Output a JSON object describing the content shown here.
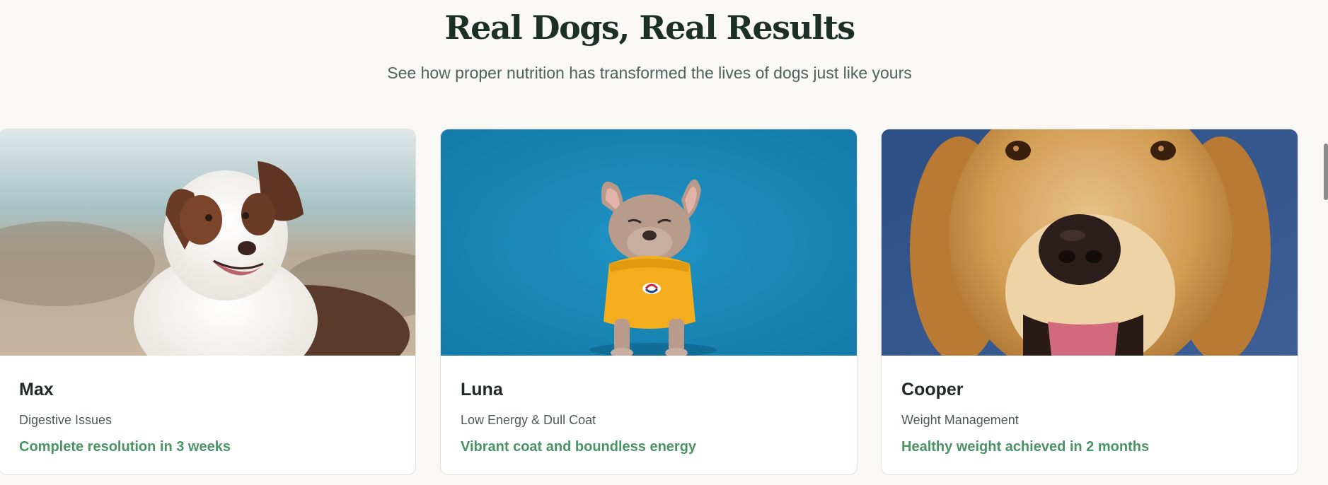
{
  "section": {
    "title": "Real Dogs, Real Results",
    "subtitle": "See how proper nutrition has transformed the lives of dogs just like yours"
  },
  "cards": [
    {
      "name": "Max",
      "issue": "Digestive Issues",
      "result": "Complete resolution in 3 weeks",
      "photo": "australian-shepherd-photo"
    },
    {
      "name": "Luna",
      "issue": "Low Energy & Dull Coat",
      "result": "Vibrant coat and boundless energy",
      "photo": "french-bulldog-photo"
    },
    {
      "name": "Cooper",
      "issue": "Weight Management",
      "result": "Healthy weight achieved in 2 months",
      "photo": "golden-retriever-photo"
    }
  ],
  "colors": {
    "background": "#f9f8f4",
    "heading": "#1d3028",
    "accent_green": "#4a9463",
    "card_bg": "#ffffff"
  }
}
